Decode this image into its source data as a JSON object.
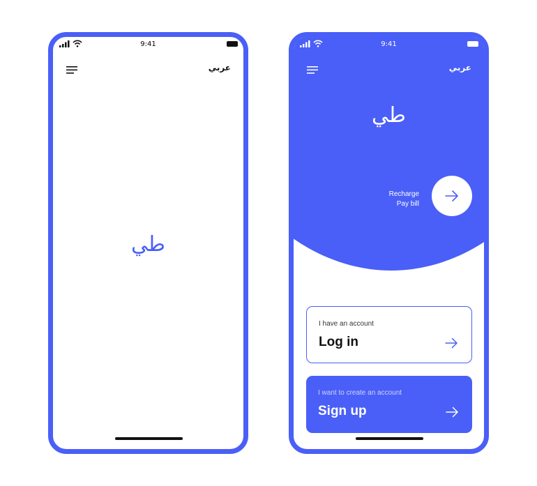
{
  "colors": {
    "brand": "#4a5ff7",
    "ink": "#111111",
    "surface": "#ffffff"
  },
  "status_bar": {
    "time": "9:41"
  },
  "header": {
    "language_toggle": "عربي"
  },
  "brand": {
    "logo_text": "طي"
  },
  "quick_actions": {
    "line1": "Recharge",
    "line2": "Pay bill"
  },
  "login_card": {
    "subtitle": "I have an account",
    "title": "Log in"
  },
  "signup_card": {
    "subtitle": "I want to create an account",
    "title": "Sign up"
  },
  "icons": {
    "menu": "hamburger-icon",
    "arrow": "arrow-right-icon",
    "signal": "signal-icon",
    "wifi": "wifi-icon",
    "battery": "battery-icon"
  }
}
